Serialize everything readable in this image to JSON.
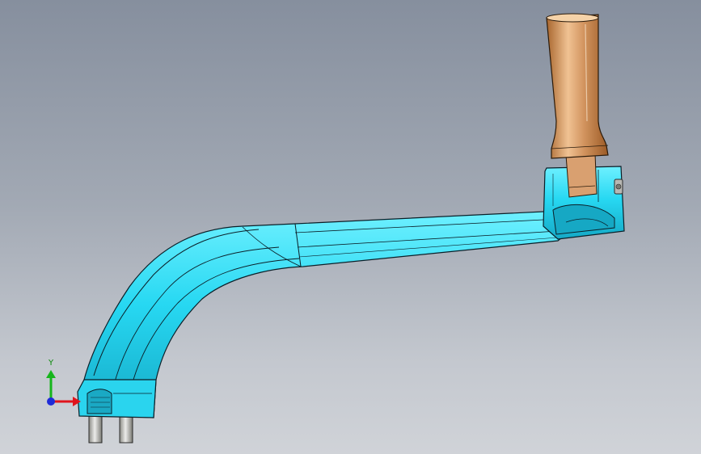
{
  "viewport": {
    "background_top": "#868f9e",
    "background_bottom": "#d0d3d8"
  },
  "model": {
    "arm_color": "#27d8f2",
    "arm_shadow_color": "#1aa9c4",
    "handle_color": "#c98a55",
    "handle_highlight_color": "#f0c293",
    "edge_color": "#0b1f28",
    "pin_color": "#c8c8c0"
  },
  "triad": {
    "y_label": "Y",
    "x_color": "#e0141c",
    "y_color": "#16b51c",
    "z_color": "#1f2bd8"
  }
}
